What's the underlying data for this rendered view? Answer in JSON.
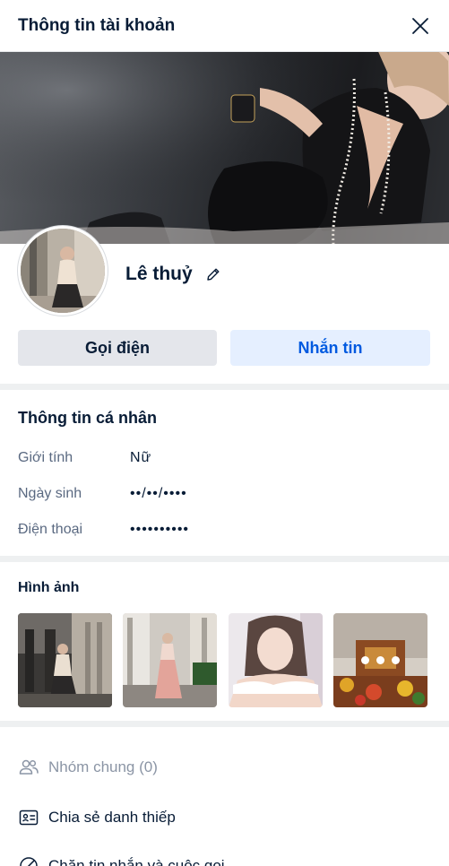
{
  "header": {
    "title": "Thông tin tài khoản",
    "close_icon": "close-icon"
  },
  "profile": {
    "name": "Lê thuỷ",
    "edit_icon": "pencil-icon"
  },
  "actions": {
    "call_label": "Gọi điện",
    "message_label": "Nhắn tin"
  },
  "personal_info": {
    "title": "Thông tin cá nhân",
    "rows": [
      {
        "label": "Giới tính",
        "value": "Nữ"
      },
      {
        "label": "Ngày sinh",
        "value": "••/••/••••"
      },
      {
        "label": "Điện thoại",
        "value": "••••••••••"
      }
    ]
  },
  "photos": {
    "title": "Hình ảnh",
    "more_icon": "more-dots-icon"
  },
  "menu": [
    {
      "label": "Nhóm chung (0)",
      "icon": "group-icon",
      "disabled": true
    },
    {
      "label": "Chia sẻ danh thiếp",
      "icon": "contact-card-icon",
      "disabled": false
    },
    {
      "label": "Chặn tin nhắn và cuộc gọi",
      "icon": "block-icon",
      "disabled": false
    }
  ],
  "colors": {
    "primary": "#005ae0",
    "message_button_bg": "#e5efff",
    "call_button_bg": "#e4e6eb",
    "divider": "#eef0f1",
    "muted_text": "#5a6981",
    "disabled_text": "#8b95a5"
  }
}
